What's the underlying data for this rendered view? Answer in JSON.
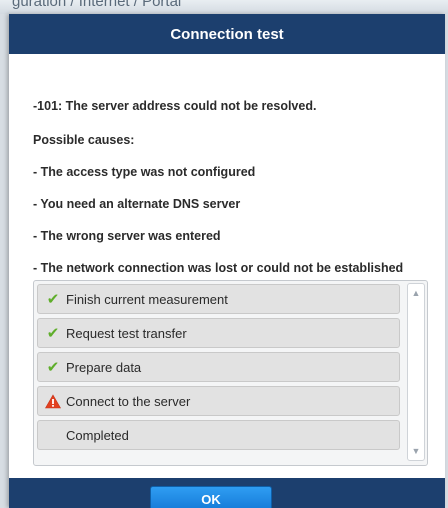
{
  "background": {
    "breadcrumb": "guration / Internet / Portal"
  },
  "dialog": {
    "title": "Connection test",
    "error_message": "-101: The server address could not be resolved.",
    "causes_heading": "Possible causes:",
    "causes": [
      "- The access type was not configured",
      "- You need an alternate DNS server",
      "- The wrong server was entered",
      "- The network connection was lost or could not be established"
    ],
    "steps": [
      {
        "label": "Finish current measurement",
        "status": "done",
        "icon": "check-icon"
      },
      {
        "label": "Request test transfer",
        "status": "done",
        "icon": "check-icon"
      },
      {
        "label": "Prepare data",
        "status": "done",
        "icon": "check-icon"
      },
      {
        "label": "Connect to the server",
        "status": "error",
        "icon": "warning-icon"
      },
      {
        "label": "Completed",
        "status": "pending",
        "icon": ""
      }
    ],
    "ok_label": "OK"
  },
  "colors": {
    "dialog_frame": "#1c3f6e",
    "check": "#5fae2b",
    "warning": "#e2401f",
    "ok_button": "#1a86e4"
  }
}
